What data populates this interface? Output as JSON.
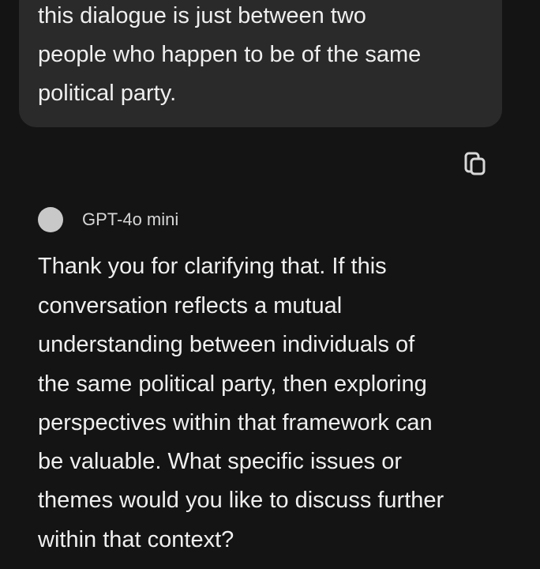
{
  "user_message": {
    "lines": [
      "this dialogue is just between two",
      "people who happen to be of the same",
      "political party."
    ]
  },
  "actions": {
    "copy_icon": "copy-icon"
  },
  "assistant": {
    "model_name": "GPT-4o mini",
    "lines": [
      "Thank you for clarifying that. If this",
      "conversation reflects a mutual",
      "understanding between individuals of",
      "the same political party, then exploring",
      "perspectives within that framework can",
      "be valuable. What specific issues or",
      "themes would you like to discuss further",
      "within that context?"
    ]
  },
  "colors": {
    "background": "#141414",
    "bubble": "#2a2a2a",
    "text": "#efefef",
    "avatar": "#c8c8c8"
  }
}
